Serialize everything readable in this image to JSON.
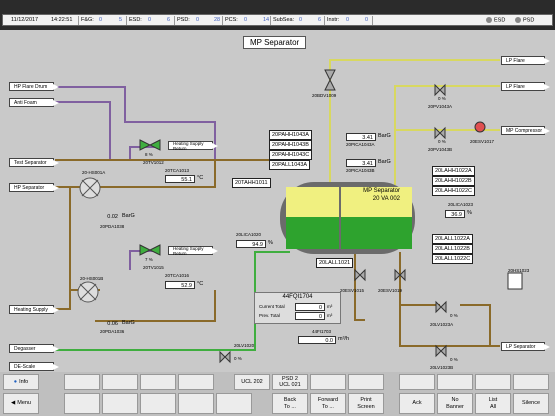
{
  "status": {
    "date": "11/12/2017",
    "time": "14:22:51",
    "fg_label": "F&G:",
    "fg_a": "0",
    "fg_b": "5",
    "esd_label": "ESD:",
    "esd_a": "0",
    "esd_b": "6",
    "psd_label": "PSD:",
    "psd_a": "0",
    "psd_b": "28",
    "pcs_label": "PCS:",
    "pcs_a": "0",
    "pcs_b": "14",
    "subsea_label": "SubSea:",
    "subsea_a": "0",
    "subsea_b": "6",
    "instr_label": "Instr:",
    "instr_a": "0",
    "instr_b": "0",
    "esd_ind": "ESD",
    "psd_ind": "PSD"
  },
  "page_title": "MP Separator",
  "left_connectors": [
    "HP Flare Drum",
    "Anti Foam",
    "Test Separator",
    "HP Separator",
    "Heating Supply",
    "Degasser",
    "DE-Scale"
  ],
  "right_connectors": [
    "LP Flare",
    "LP Flare",
    "MP Compressor",
    "LP Separator"
  ],
  "heater": {
    "top_valve_pct": "8 %",
    "top_valve_tag": "20TV1012",
    "top_link": "Heating Supply Return",
    "top_temp_tag": "20TCA1013",
    "top_temp": "55.1",
    "top_temp_unit": "°C",
    "hx_top_tag": "20-HS001A",
    "press_val": "0.02",
    "press_unit": "BarG",
    "press_tag": "20PDA1038",
    "bot_valve_pct": "7 %",
    "bot_valve_tag": "20TV1015",
    "bot_link": "Heating Supply Return",
    "bot_temp_tag": "20TCA1016",
    "bot_temp": "52.9",
    "bot_temp_unit": "°C",
    "hx_bot_tag": "20-HS001B",
    "press2_val": "0.06",
    "press2_unit": "BarG",
    "press2_tag": "20PDA1036"
  },
  "separator": {
    "name": "MP Separator",
    "id": "20 VA 002",
    "inlet_tag": "20TAHH1011",
    "lvl_tag": "20LICA1020",
    "lvl_val": "94.9",
    "lvl_unit": "%",
    "lall_tag": "20LALL1021",
    "pahh": [
      "20PAHH1043A",
      "20PAHH1043B",
      "20PAHH1043C",
      "20PALL1043A"
    ],
    "pica1_val": "3.41",
    "pica1_unit": "BarG",
    "pica1_tag": "20PICA1043A",
    "pica2_val": "3.41",
    "pica2_unit": "BarG",
    "pica2_tag": "20PICA1043B",
    "lahh": [
      "20LAHH1022A",
      "20LAHH1022B",
      "20LAHH1022C"
    ],
    "lica_tag": "20LICA1023",
    "lica_val": "36.9",
    "lica_unit": "%",
    "lall": [
      "20LALL1022A",
      "20LALL1022B",
      "20LALL1022C"
    ],
    "vent_tag": "20BDV1009",
    "pv1_pct": "0 %",
    "pv1_tag": "20PV1043A",
    "pv2_pct": "0 %",
    "pv2_tag": "20PV1043B",
    "sdv_tag": "20ESV1017",
    "esv_tag": "20ESV1015",
    "esv2_tag": "20ESV1019",
    "hs_tag": "20HS1023",
    "lv1_pct": "0 %",
    "lv1_tag": "20LV1023A",
    "lv2_pct": "0 %",
    "lv2_tag": "20LV1023B",
    "lv_left_pct": "0 %",
    "lv_left_tag": "20LV1020"
  },
  "flow": {
    "title": "44FQI1704",
    "current_label": "Current Total",
    "current_val": "0",
    "current_unit": "m³",
    "prev_label": "Prev. Total",
    "prev_val": "0",
    "prev_unit": "m³",
    "rate_tag": "44FI1703",
    "rate_val": "0.0",
    "rate_unit": "m³/h"
  },
  "buttons": {
    "info": "Info",
    "menu": "Menu",
    "ucl202": "UCL 202",
    "psd2": "PSD 2\nUCL 021",
    "back": "Back\nTo ...",
    "forward": "Forward\nTo ...",
    "print": "Print\nScreen",
    "ack": "Ack",
    "no_banner": "No\nBanner",
    "list_all": "List\nAll",
    "silence": "Silence"
  },
  "colors": {
    "gas": "#f0f080",
    "liquid": "#2ea32e",
    "pipe_brown": "#8a6a2a",
    "pipe_green": "#3fae3f",
    "pipe_purple": "#8060a0",
    "pipe_yellow": "#d8d860"
  }
}
